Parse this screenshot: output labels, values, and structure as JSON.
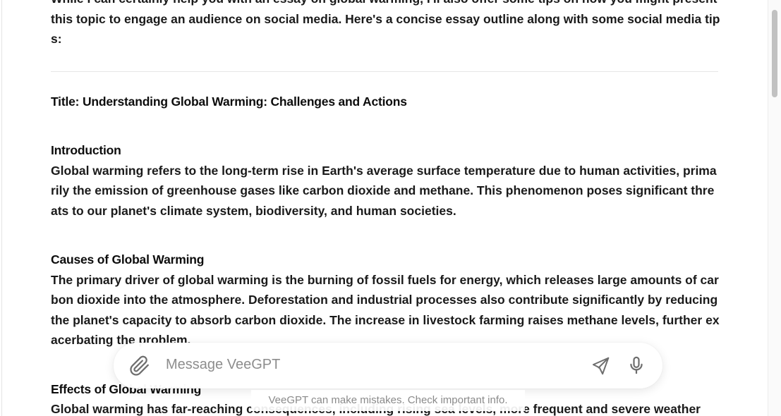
{
  "response": {
    "intro": "While I can certainly help you with an essay on global warming, I'll also offer some tips on how you might present this topic to engage an audience on social media. Here's a concise essay outline along with some social media tips:",
    "title": "Title: Understanding Global Warming: Challenges and Actions",
    "sections": [
      {
        "heading": "Introduction",
        "body": "Global warming refers to the long-term rise in Earth's average surface temperature due to human activities, primarily the emission of greenhouse gases like carbon dioxide and methane. This phenomenon poses significant threats to our planet's climate system, biodiversity, and human societies."
      },
      {
        "heading": "Causes of Global Warming",
        "body": "The primary driver of global warming is the burning of fossil fuels for energy, which releases large amounts of carbon dioxide into the atmosphere. Deforestation and industrial processes also contribute significantly by reducing the planet's capacity to absorb carbon dioxide. The increase in livestock farming raises methane levels, further exacerbating the problem."
      },
      {
        "heading": "Effects of Global Warming",
        "body": "Global warming has far-reaching consequences, including rising sea levels, more frequent and severe weather"
      }
    ]
  },
  "composer": {
    "placeholder": "Message VeeGPT",
    "value": ""
  },
  "footer": {
    "disclaimer": "VeeGPT can make mistakes. Check important info."
  },
  "icons": {
    "attach": "paperclip-icon",
    "send": "send-icon",
    "mic": "microphone-icon"
  },
  "colors": {
    "text": "#1a1a1a",
    "icon": "#6e6e6e",
    "placeholder": "#8d8d8d"
  }
}
